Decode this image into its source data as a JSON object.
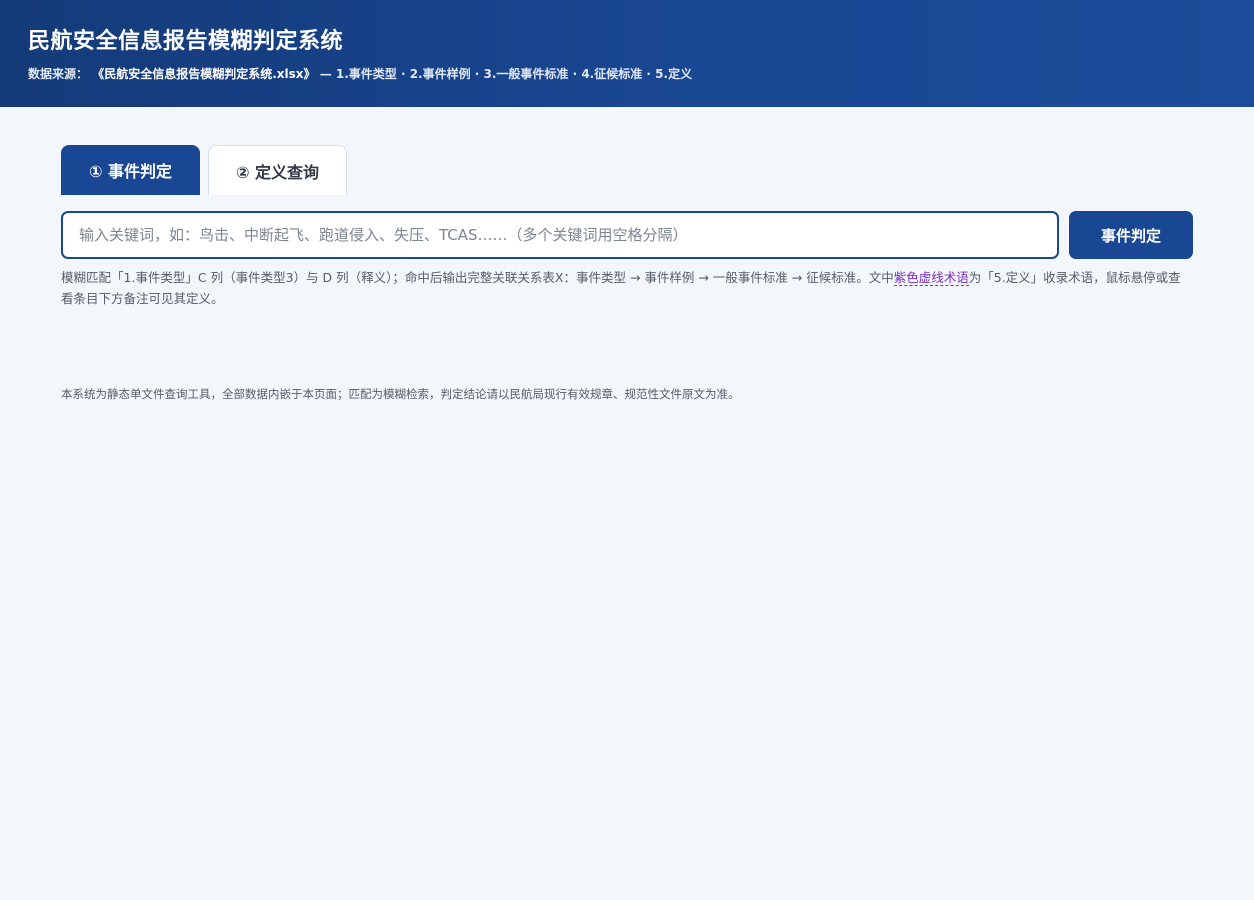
{
  "header": {
    "title": "民航安全信息报告模糊判定系统",
    "source_label": "数据来源：",
    "source_file": "《民航安全信息报告模糊判定系统.xlsx》",
    "source_sheets": " — 1.事件类型 · 2.事件样例 · 3.一般事件标准 · 4.征候标准 · 5.定义"
  },
  "tabs": [
    {
      "label": "① 事件判定",
      "active": true
    },
    {
      "label": "② 定义查询",
      "active": false
    }
  ],
  "search": {
    "value": "",
    "placeholder": "输入关键词，如：鸟击、中断起飞、跑道侵入、失压、TCAS……（多个关键词用空格分隔）",
    "button_label": "事件判定"
  },
  "hint": {
    "before": "模糊匹配「1.事件类型」C 列（事件类型3）与 D 列（释义）；命中后输出完整关联关系表X：事件类型 → 事件样例 → 一般事件标准 → 征候标准。文中",
    "term": "紫色虚线术语",
    "after": "为「5.定义」收录术语，鼠标悬停或查看条目下方备注可见其定义。"
  },
  "footer": {
    "note": "本系统为静态单文件查询工具，全部数据内嵌于本页面；匹配为模糊检索，判定结论请以民航局现行有效规章、规范性文件原文为准。"
  },
  "colors": {
    "header_bg": "#1a4794",
    "accent": "#1a4794",
    "page_bg": "#f3f6fb",
    "term": "#7a2fc4"
  }
}
